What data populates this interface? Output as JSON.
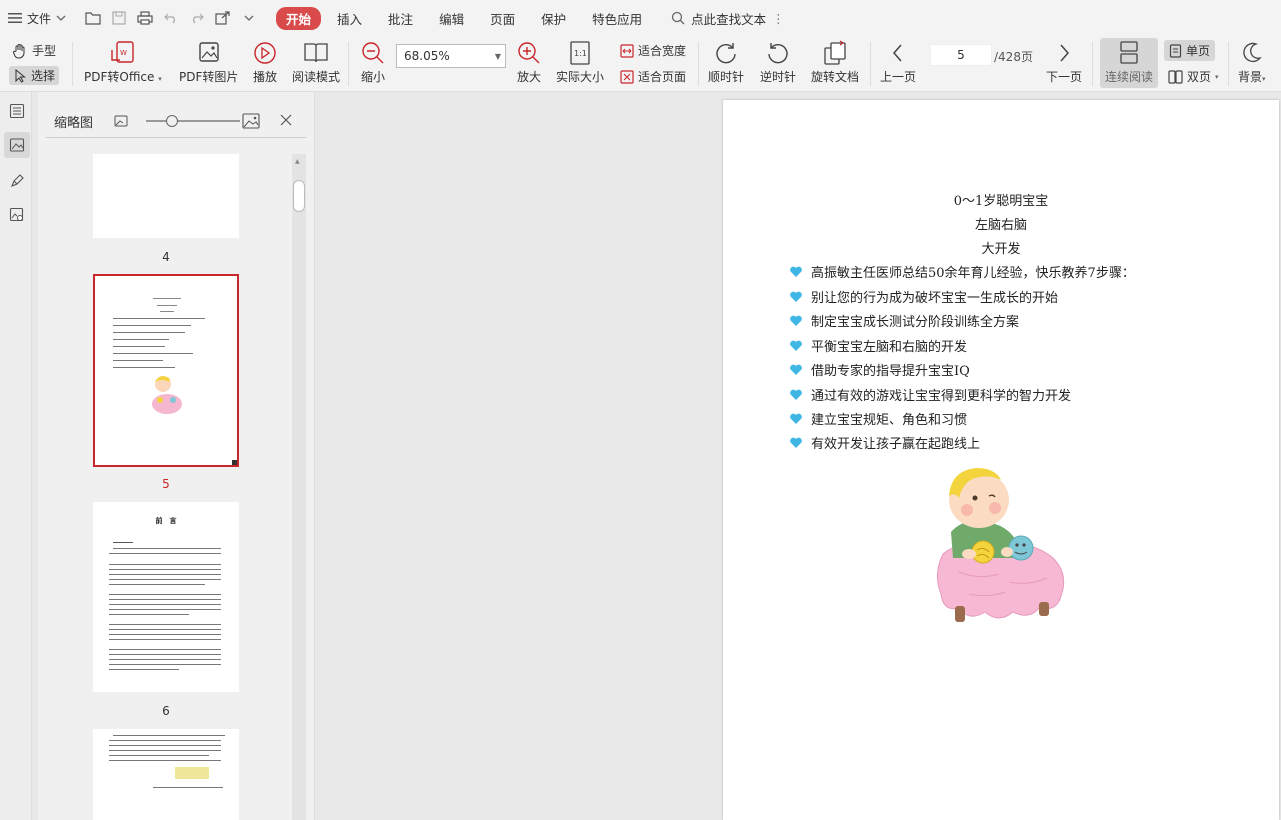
{
  "menubar": {
    "file_label": "文件",
    "tabs": [
      {
        "label": "开始",
        "active": true
      },
      {
        "label": "插入",
        "active": false
      },
      {
        "label": "批注",
        "active": false
      },
      {
        "label": "编辑",
        "active": false
      },
      {
        "label": "页面",
        "active": false
      },
      {
        "label": "保护",
        "active": false
      },
      {
        "label": "特色应用",
        "active": false
      }
    ],
    "search_label": "点此查找文本"
  },
  "toolbar": {
    "hand_label": "手型",
    "select_label": "选择",
    "pdf_to_office": "PDF转Office",
    "pdf_to_image": "PDF转图片",
    "play": "播放",
    "read_mode": "阅读模式",
    "zoom_out": "缩小",
    "zoom_value": "68.05%",
    "zoom_in": "放大",
    "actual_size": "实际大小",
    "fit_width": "适合宽度",
    "fit_page": "适合页面",
    "rotate_cw": "顺时针",
    "rotate_ccw": "逆时针",
    "rotate_doc": "旋转文档",
    "prev_page": "上一页",
    "page_current": "5",
    "page_total": "/428页",
    "next_page": "下一页",
    "continuous": "连续阅读",
    "single": "单页",
    "double": "双页",
    "background": "背景"
  },
  "thumbnails": {
    "title": "缩略图",
    "pages": [
      {
        "number": "4",
        "selected": false
      },
      {
        "number": "5",
        "selected": true
      },
      {
        "number": "6",
        "selected": false
      }
    ],
    "thumb6_heading": "前　言"
  },
  "document": {
    "title_lines": [
      "0～1岁聪明宝宝",
      "左脑右脑",
      "大开发"
    ],
    "bullets": [
      "高振敏主任医师总结50余年育儿经验，快乐教养7步骤：",
      "别让您的行为成为破坏宝宝一生成长的开始",
      "制定宝宝成长测试分阶段训练全方案",
      "平衡宝宝左脑和右脑的开发",
      "借助专家的指导提升宝宝IQ",
      "通过有效的游戏让宝宝得到更科学的智力开发",
      "建立宝宝规矩、角色和习惯",
      "有效开发让孩子赢在起跑线上"
    ]
  },
  "colors": {
    "accent": "#d94a4a",
    "selected_thumb": "#c8262b",
    "heart": "#3fb6e3"
  }
}
